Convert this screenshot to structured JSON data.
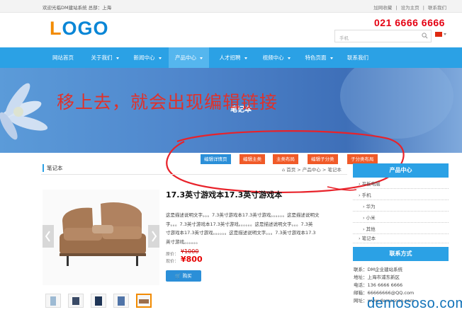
{
  "topbar": {
    "welcome": "欢迎光临DM建站系统 总部：上海",
    "links": [
      "加网收藏",
      "设为主页",
      "联系我们"
    ]
  },
  "logo": {
    "part1": "L",
    "part2": "OGO"
  },
  "phone": "021 6666 6666",
  "search": {
    "placeholder": "手机"
  },
  "nav": {
    "items": [
      {
        "label": "网站首页",
        "caret": false
      },
      {
        "label": "关于我们",
        "caret": true
      },
      {
        "label": "新闻中心",
        "caret": true
      },
      {
        "label": "产品中心",
        "caret": true
      },
      {
        "label": "人才招聘",
        "caret": true
      },
      {
        "label": "视频中心",
        "caret": true
      },
      {
        "label": "特色页面",
        "caret": true
      },
      {
        "label": "联系我们",
        "caret": false
      }
    ]
  },
  "overlay": {
    "text": "移上去，就会出现编辑链接"
  },
  "banner": {
    "title": "笔记本"
  },
  "edit_buttons": [
    {
      "label": "编辑详情页",
      "color": "#2b8fd8"
    },
    {
      "label": "编辑主类",
      "color": "#f05a28"
    },
    {
      "label": "主类布局",
      "color": "#f05a28"
    },
    {
      "label": "编辑子分类",
      "color": "#f05a28"
    },
    {
      "label": "子分类布局",
      "color": "#f05a28"
    }
  ],
  "category_title": "笔记本",
  "breadcrumb": "首页 > 产品中心 > 笔记本",
  "product": {
    "title": "17.3英寸游戏本17.3英寸游戏本",
    "description": [
      "这是描述说明文字。。。7.3英寸游戏本17.3英寸游戏。。。。。。这是描述说明文",
      "字。。。7.3英寸游戏本17.3英寸游戏。。。。。。这是描述说明文字。。。7.3英",
      "寸游戏本17.3英寸游戏。。。。。。这是描述说明文字。。。7.3英寸游戏本17.3",
      "英寸游戏。。。。。。"
    ],
    "old_price_label": "原价：",
    "old_price": "¥1000",
    "price_label": "现价：",
    "price": "¥800",
    "buy_label": "购买"
  },
  "sidebar": {
    "title": "产品中心",
    "items": [
      "平板电脑",
      "手机",
      "华为",
      "小米",
      "其他",
      "笔记本"
    ],
    "contact_title": "联系方式",
    "contact": [
      "联系：DM企业建站系统",
      "地址：上海市浦东新区",
      "电话：136 6666 6666",
      "邮箱：66666666@QQ.com",
      "网址：www.demososo.com"
    ]
  },
  "watermark": "demososo.com",
  "colors": {
    "nav": "#2ba1e5",
    "accent_red": "#e50012",
    "edit_orange": "#f05a28",
    "edit_blue": "#2b8fd8"
  }
}
